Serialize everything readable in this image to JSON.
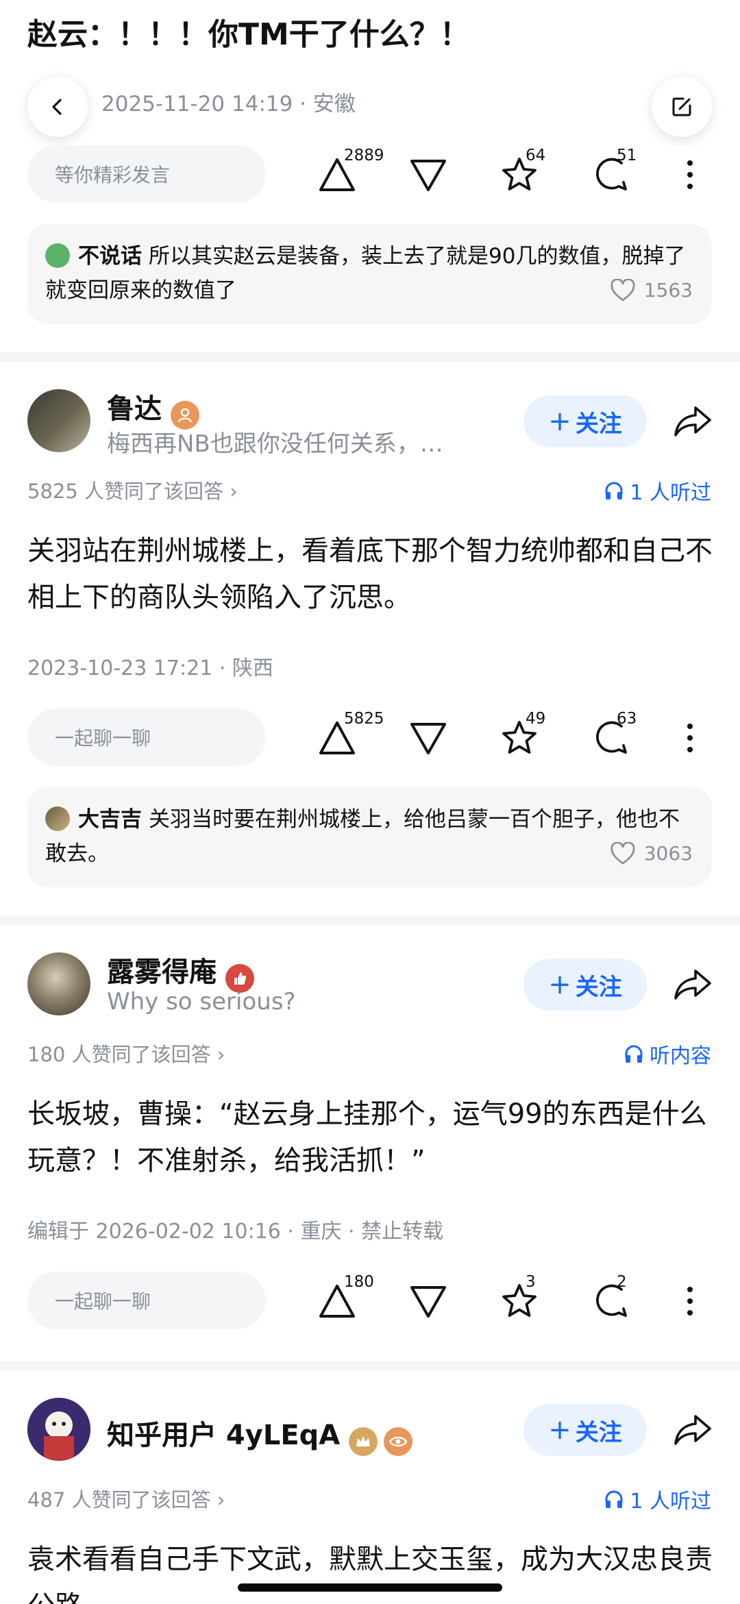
{
  "question": {
    "title": "赵云：！！！你TM干了什么？！",
    "meta_suffix": "2025-11-20 14:19 · 安徽",
    "input_placeholder": "等你精彩发言",
    "upvotes": "2889",
    "favorites": "64",
    "comments": "51",
    "top_comment": {
      "user": "不说话",
      "text": "所以其实赵云是装备，装上去了就是90几的数值，脱掉了就变回原来的数值了",
      "likes": "1563"
    }
  },
  "answers": [
    {
      "author": "鲁达",
      "bio": "梅西再NB也跟你没任何关系，…",
      "follow_label": "关注",
      "voters": "5825 人赞同了该回答 ›",
      "listen": "1 人听过",
      "content": "关羽站在荆州城楼上，看着底下那个智力统帅都和自己不相上下的商队头领陷入了沉思。",
      "meta": "2023-10-23 17:21 · 陕西",
      "input_placeholder": "一起聊一聊",
      "upvotes": "5825",
      "favorites": "49",
      "comments": "63",
      "top_comment": {
        "user": "大吉吉",
        "text": "关羽当时要在荆州城楼上，给他吕蒙一百个胆子，他也不敢去。",
        "likes": "3063"
      }
    },
    {
      "author": "露雾得庵",
      "bio": "Why so serious?",
      "follow_label": "关注",
      "voters": "180 人赞同了该回答 ›",
      "listen": "听内容",
      "content": "长坂坡，曹操：“赵云身上挂那个，运气99的东西是什么玩意？！不准射杀，给我活抓！”",
      "meta": "编辑于 2026-02-02 10:16 · 重庆 · 禁止转载",
      "input_placeholder": "一起聊一聊",
      "upvotes": "180",
      "favorites": "3",
      "comments": "2"
    },
    {
      "author": "知乎用户 4yLEqA",
      "follow_label": "关注",
      "voters": "487 人赞同了该回答 ›",
      "listen": "1 人听过",
      "content": "袁术看看自己手下文武，默默上交玉玺，成为大汉忠良责公路"
    }
  ],
  "colors": {
    "accent": "#1a66ff",
    "muted": "#8a8f99",
    "follow_bg": "#ebf2ff"
  }
}
